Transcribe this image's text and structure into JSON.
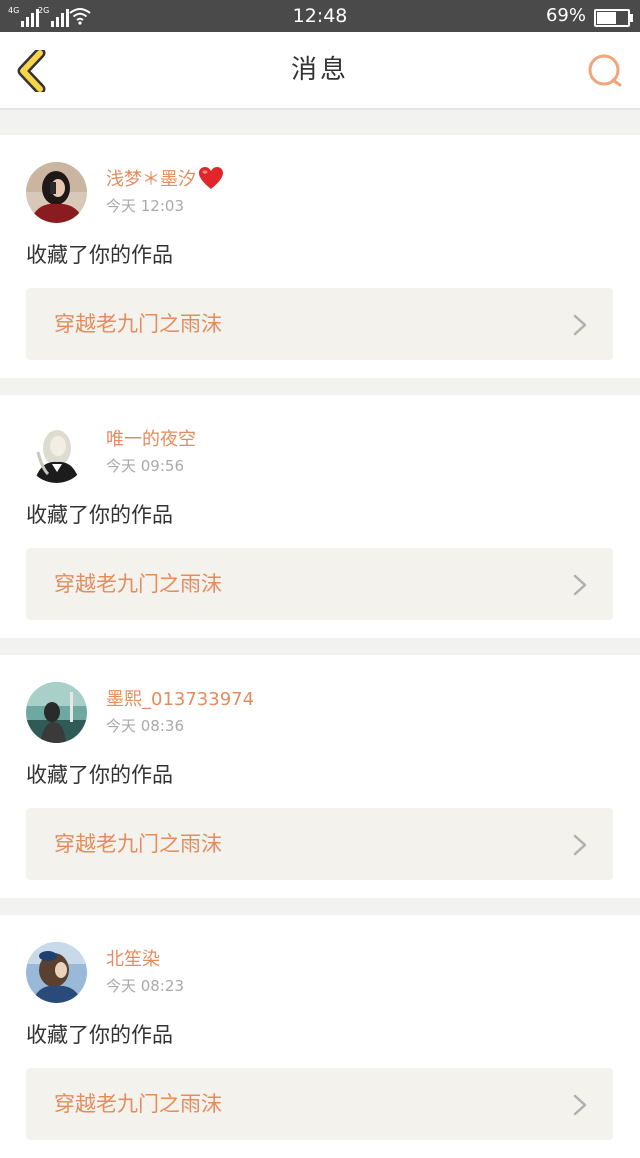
{
  "status_bar": {
    "net1": "4G",
    "net2": "2G",
    "time": "12:48",
    "battery": "69%",
    "battery_level": 0.69,
    "icons": [
      "signal-icon",
      "signal-icon",
      "wifi-icon",
      "battery-icon"
    ]
  },
  "header": {
    "title": "消息",
    "back_icon": "back-chevron-icon",
    "search_icon": "search-icon"
  },
  "colors": {
    "accent": "#e58c5e",
    "back_icon_fill": "#f7d44a",
    "status_bar_bg": "#4a4a4a",
    "page_bg": "#f2f2f0",
    "link_bg": "#f3f2ec"
  },
  "messages": [
    {
      "username": "浅梦＊墨汐",
      "badge_icon": "heart-icon",
      "time": "今天 12:03",
      "action": "收藏了你的作品",
      "work_title": "穿越老九门之雨沫"
    },
    {
      "username": "唯一的夜空",
      "time": "今天 09:56",
      "action": "收藏了你的作品",
      "work_title": "穿越老九门之雨沫"
    },
    {
      "username": "墨熙_013733974",
      "time": "今天 08:36",
      "action": "收藏了你的作品",
      "work_title": "穿越老九门之雨沫"
    },
    {
      "username": "北笙染",
      "time": "今天 08:23",
      "action": "收藏了你的作品",
      "work_title": "穿越老九门之雨沫"
    }
  ]
}
